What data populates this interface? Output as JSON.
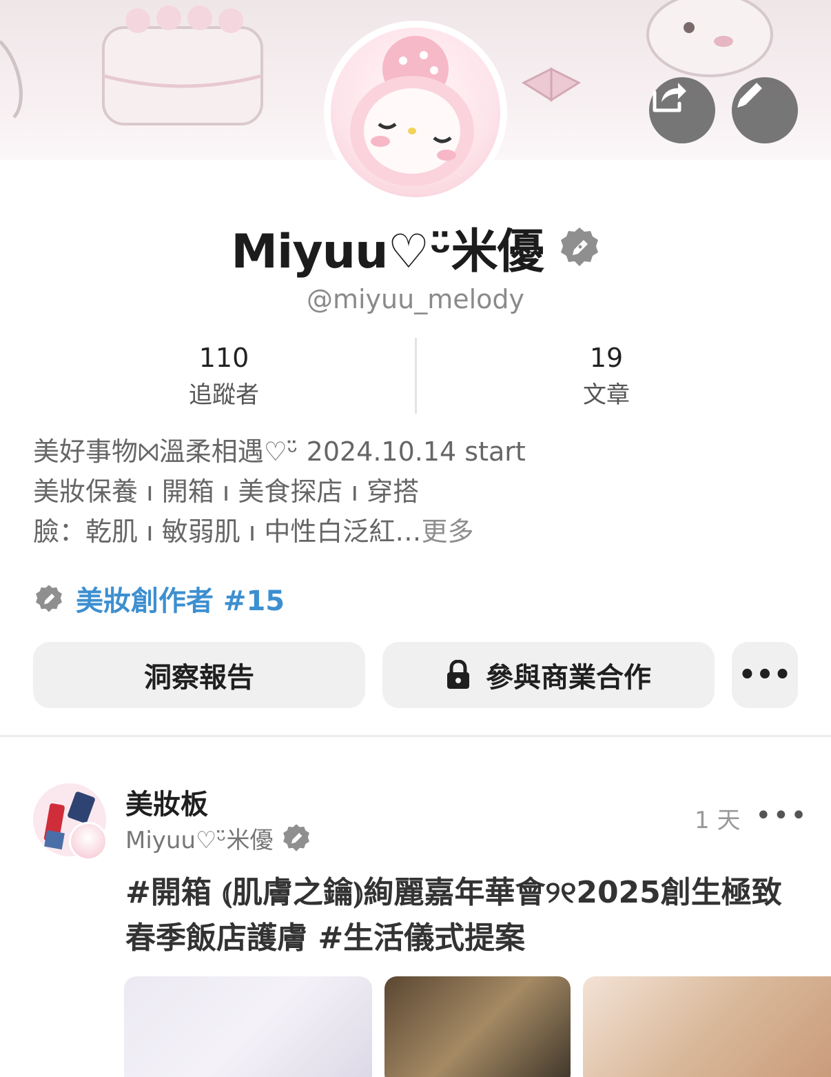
{
  "profile": {
    "display_name": "Miyuu♡ᵕ̈米優",
    "handle": "@miyuu_melody",
    "stats": {
      "followers_count": "110",
      "followers_label": "追蹤者",
      "articles_count": "19",
      "articles_label": "文章"
    },
    "bio_lines": [
      "美好事物⨝溫柔相遇♡ᵕ̈  2024.10.14 start",
      "美妝保養 ı 開箱 ı 美食探店 ı 穿搭",
      "臉：乾肌 ı 敏弱肌 ı 中性白泛紅…"
    ],
    "bio_more": "更多",
    "rank": "美妝創作者 #15",
    "buttons": {
      "insights": "洞察報告",
      "business": "參與商業合作",
      "more": "•••"
    }
  },
  "post": {
    "board": "美妝板",
    "author": "Miyuu♡ᵕ̈米優",
    "time": "1 天",
    "menu": "•••",
    "title": "#開箱 ⦅肌膚之鑰⦆絢麗嘉年華會୨୧2025創生極致春季飯店護膚 #生活儀式提案"
  },
  "colors": {
    "accent_blue": "#3d8fd0",
    "badge_gray": "#8f8f8f",
    "button_bg": "#f0f0f0"
  },
  "icons": [
    "share-icon",
    "edit-pencil-icon",
    "creator-badge-icon",
    "lock-icon",
    "more-icon"
  ]
}
